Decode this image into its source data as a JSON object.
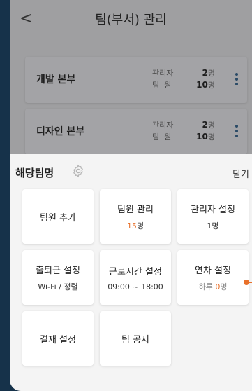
{
  "header": {
    "back_glyph": "<",
    "title": "팀(부서) 관리"
  },
  "teams": [
    {
      "name": "개발 본부",
      "admin_label": "관리자",
      "admin_count": "2",
      "member_label": "팀  원",
      "member_count": "10",
      "unit": "명"
    },
    {
      "name": "디자인 본부",
      "admin_label": "관리자",
      "admin_count": "2",
      "member_label": "팀  원",
      "member_count": "10",
      "unit": "명"
    }
  ],
  "sheet": {
    "title": "해당팀명",
    "close_label": "닫기",
    "tiles": [
      {
        "label": "팀원 추가"
      },
      {
        "label": "팀원 관리",
        "sub_value": "15",
        "sub_unit": "명"
      },
      {
        "label": "관리자 설정",
        "sub": "1명"
      },
      {
        "label": "출퇴근 설정",
        "sub": "Wi-Fi / 정렬"
      },
      {
        "label": "근로시간 설정",
        "sub": "09:00 ~ 18:00"
      },
      {
        "label": "연차 설정",
        "sub_prefix": "하루 ",
        "sub_value": "0",
        "sub_unit": "명"
      },
      {
        "label": "결재 설정"
      },
      {
        "label": "팀 공지"
      }
    ]
  },
  "colors": {
    "accent": "#e8702a",
    "kebab": "#2a4a66",
    "outer_background": "#16324a"
  },
  "icons": {
    "back": "chevron-left-icon",
    "settings": "gear-icon",
    "more": "kebab-icon"
  }
}
